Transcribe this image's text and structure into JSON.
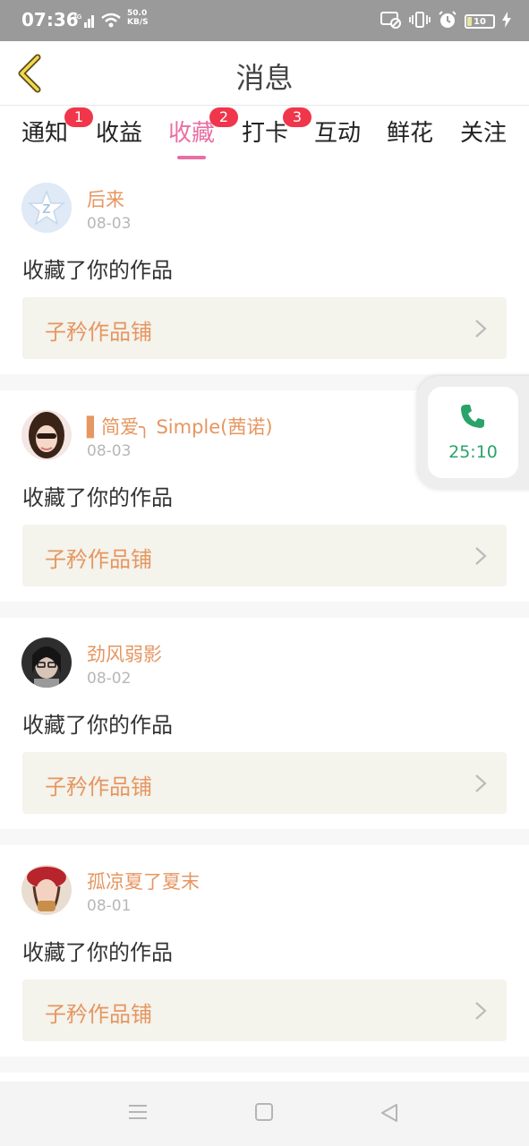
{
  "status": {
    "time": "07:36",
    "network": "4G",
    "speed_value": "50.0",
    "speed_unit": "KB/S",
    "battery": "10"
  },
  "header": {
    "title": "消息"
  },
  "tabs": [
    {
      "label": "通知",
      "badge": "1",
      "active": false
    },
    {
      "label": "收益",
      "badge": "",
      "active": false
    },
    {
      "label": "收藏",
      "badge": "2",
      "active": true
    },
    {
      "label": "打卡",
      "badge": "3",
      "active": false
    },
    {
      "label": "互动",
      "badge": "",
      "active": false
    },
    {
      "label": "鲜花",
      "badge": "",
      "active": false
    },
    {
      "label": "关注",
      "badge": "",
      "active": false
    }
  ],
  "items": [
    {
      "username": "后来",
      "date": "08-03",
      "action": "收藏了你的作品",
      "shop": "子矜作品铺",
      "avatar": "default-avatar"
    },
    {
      "username": "▌简爱╮ Simple(茜诺)",
      "date": "08-03",
      "action": "收藏了你的作品",
      "shop": "子矜作品铺",
      "avatar": "photo-avatar"
    },
    {
      "username": "劲风弱影",
      "date": "08-02",
      "action": "收藏了你的作品",
      "shop": "子矜作品铺",
      "avatar": "photo-avatar"
    },
    {
      "username": "孤凉夏了夏末",
      "date": "08-01",
      "action": "收藏了你的作品",
      "shop": "子矜作品铺",
      "avatar": "photo-avatar"
    }
  ],
  "call_widget": {
    "duration": "25:10",
    "icon": "phone-icon"
  },
  "colors": {
    "accent": "#e86fa3",
    "username": "#e69660",
    "badge": "#f0364b",
    "call_green": "#2aa36a"
  },
  "nav": {
    "icons": [
      "menu-icon",
      "home-square-icon",
      "back-triangle-icon"
    ]
  }
}
